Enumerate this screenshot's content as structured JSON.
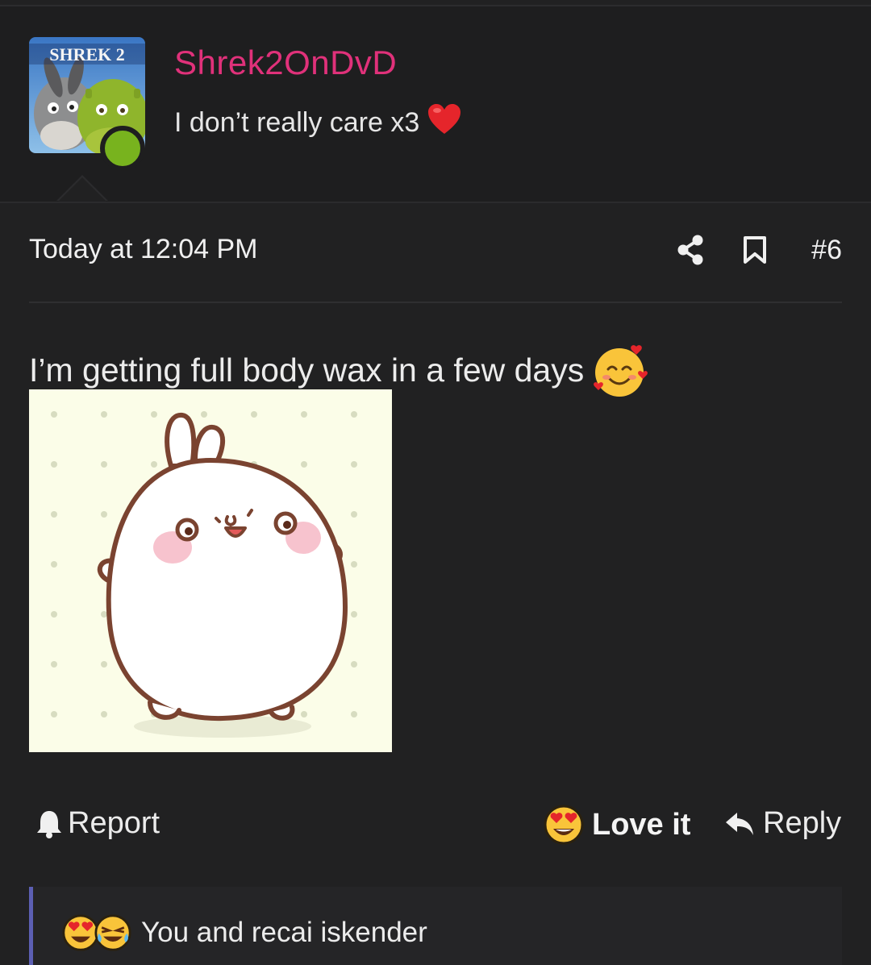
{
  "user": {
    "username": "Shrek2OnDvD",
    "title": "I don’t really care x3",
    "title_icon": "red-heart-icon",
    "avatar_text": "SHREK 2",
    "online_color": "#78b31e",
    "username_color": "#e0317a"
  },
  "post": {
    "date": "Today at 12:04 PM",
    "number": "#6",
    "text": "I’m getting full body wax in a few days",
    "text_emoji": "smiling-face-with-hearts-icon",
    "image_description_icon": "molang-bunny-image"
  },
  "actions": {
    "report_label": "Report",
    "love_label": "Love it",
    "reply_label": "Reply"
  },
  "reactions": {
    "summary": "You and recai iskender",
    "icons": [
      "heart-eyes-icon",
      "crying-laughing-icon"
    ],
    "accent_color": "#5c5fb3"
  }
}
